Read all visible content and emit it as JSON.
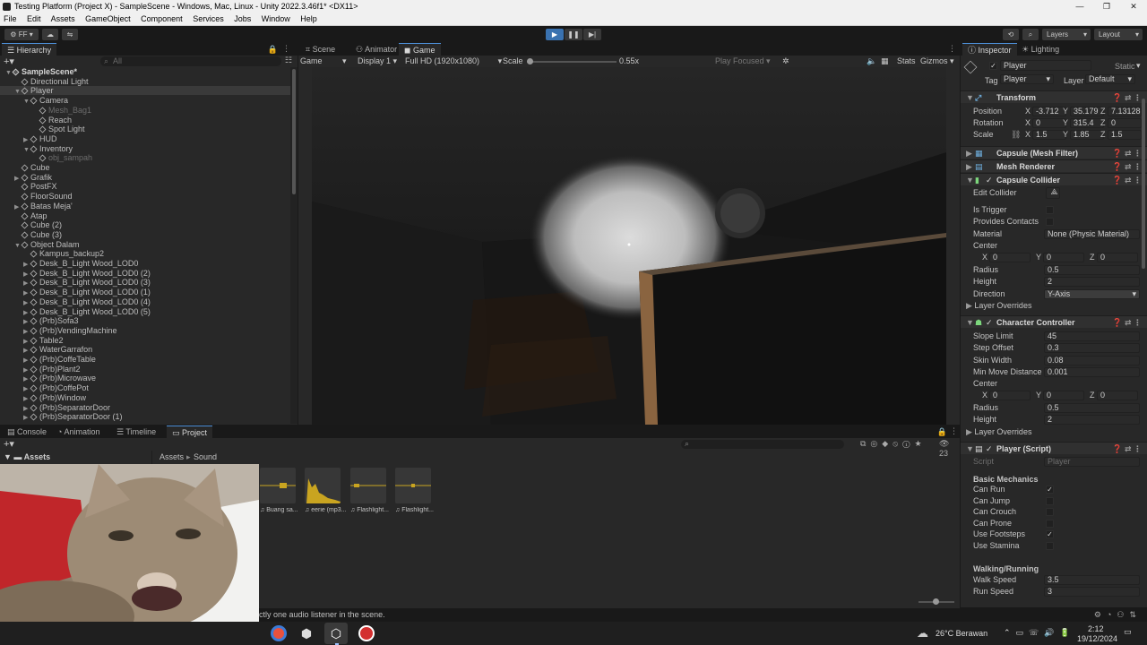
{
  "window": {
    "title": "Testing Platform (Project X) - SampleScene - Windows, Mac, Linux - Unity 2022.3.46f1* <DX11>"
  },
  "menu": [
    "File",
    "Edit",
    "Assets",
    "GameObject",
    "Component",
    "Services",
    "Jobs",
    "Window",
    "Help"
  ],
  "toolbar": {
    "account": "FF",
    "layers": "Layers",
    "layout": "Layout"
  },
  "hierarchy": {
    "tab": "Hierarchy",
    "search_placeholder": "All",
    "items": [
      {
        "label": "SampleScene*",
        "depth": 0,
        "arrow": "▼",
        "dim": false,
        "icon": "unity"
      },
      {
        "label": "Directional Light",
        "depth": 1,
        "arrow": "",
        "dim": false
      },
      {
        "label": "Player",
        "depth": 1,
        "arrow": "▼",
        "dim": false
      },
      {
        "label": "Camera",
        "depth": 2,
        "arrow": "▼",
        "dim": false
      },
      {
        "label": "Mesh_Bag1",
        "depth": 3,
        "arrow": "",
        "dim": true
      },
      {
        "label": "Reach",
        "depth": 3,
        "arrow": "",
        "dim": false
      },
      {
        "label": "Spot Light",
        "depth": 3,
        "arrow": "",
        "dim": false
      },
      {
        "label": "HUD",
        "depth": 2,
        "arrow": "▶",
        "dim": false
      },
      {
        "label": "Inventory",
        "depth": 2,
        "arrow": "▼",
        "dim": false
      },
      {
        "label": "obj_sampah",
        "depth": 3,
        "arrow": "",
        "dim": true
      },
      {
        "label": "Cube",
        "depth": 1,
        "arrow": "",
        "dim": false
      },
      {
        "label": "Grafik",
        "depth": 1,
        "arrow": "▶",
        "dim": false
      },
      {
        "label": "PostFX",
        "depth": 1,
        "arrow": "",
        "dim": false
      },
      {
        "label": "FloorSound",
        "depth": 1,
        "arrow": "",
        "dim": false
      },
      {
        "label": "Batas Meja'",
        "depth": 1,
        "arrow": "▶",
        "dim": false
      },
      {
        "label": "Atap",
        "depth": 1,
        "arrow": "",
        "dim": false
      },
      {
        "label": "Cube (2)",
        "depth": 1,
        "arrow": "",
        "dim": false
      },
      {
        "label": "Cube (3)",
        "depth": 1,
        "arrow": "",
        "dim": false
      },
      {
        "label": "Object Dalam",
        "depth": 1,
        "arrow": "▼",
        "dim": false
      },
      {
        "label": "Kampus_backup2",
        "depth": 2,
        "arrow": "",
        "dim": false
      },
      {
        "label": "Desk_B_Light Wood_LOD0",
        "depth": 2,
        "arrow": "▶",
        "dim": false
      },
      {
        "label": "Desk_B_Light Wood_LOD0 (2)",
        "depth": 2,
        "arrow": "▶",
        "dim": false
      },
      {
        "label": "Desk_B_Light Wood_LOD0 (3)",
        "depth": 2,
        "arrow": "▶",
        "dim": false
      },
      {
        "label": "Desk_B_Light Wood_LOD0 (1)",
        "depth": 2,
        "arrow": "▶",
        "dim": false
      },
      {
        "label": "Desk_B_Light Wood_LOD0 (4)",
        "depth": 2,
        "arrow": "▶",
        "dim": false
      },
      {
        "label": "Desk_B_Light Wood_LOD0 (5)",
        "depth": 2,
        "arrow": "▶",
        "dim": false
      },
      {
        "label": "(Prb)Sofa3",
        "depth": 2,
        "arrow": "▶",
        "dim": false
      },
      {
        "label": "(Prb)VendingMachine",
        "depth": 2,
        "arrow": "▶",
        "dim": false
      },
      {
        "label": "Table2",
        "depth": 2,
        "arrow": "▶",
        "dim": false
      },
      {
        "label": "WaterGarrafon",
        "depth": 2,
        "arrow": "▶",
        "dim": false
      },
      {
        "label": "(Prb)CoffeTable",
        "depth": 2,
        "arrow": "▶",
        "dim": false
      },
      {
        "label": "(Prb)Plant2",
        "depth": 2,
        "arrow": "▶",
        "dim": false
      },
      {
        "label": "(Prb)Microwave",
        "depth": 2,
        "arrow": "▶",
        "dim": false
      },
      {
        "label": "(Prb)CoffePot",
        "depth": 2,
        "arrow": "▶",
        "dim": false
      },
      {
        "label": "(Prb)Window",
        "depth": 2,
        "arrow": "▶",
        "dim": false
      },
      {
        "label": "(Prb)SeparatorDoor",
        "depth": 2,
        "arrow": "▶",
        "dim": false
      },
      {
        "label": "(Prb)SeparatorDoor (1)",
        "depth": 2,
        "arrow": "▶",
        "dim": false
      }
    ]
  },
  "game_view": {
    "tabs": [
      "Scene",
      "Animator",
      "Game"
    ],
    "display_mode": "Game",
    "display": "Display 1",
    "resolution": "Full HD (1920x1080)",
    "scale_label": "Scale",
    "scale_value": "0.55x",
    "play_focused": "Play Focused",
    "stats": "Stats",
    "gizmos": "Gizmos",
    "scale_fraction": 0.0
  },
  "inspector": {
    "tabs": [
      "Inspector",
      "Lighting"
    ],
    "object_name": "Player",
    "static_label": "Static",
    "tag_label": "Tag",
    "tag_value": "Player",
    "layer_label": "Layer",
    "layer_value": "Default",
    "transform": {
      "title": "Transform",
      "position_label": "Position",
      "position": {
        "x": "-3.712",
        "y": "35.179",
        "z": "7.13128"
      },
      "rotation_label": "Rotation",
      "rotation": {
        "x": "0",
        "y": "315.4",
        "z": "0"
      },
      "scale_label": "Scale",
      "scale": {
        "x": "1.5",
        "y": "1.85",
        "z": "1.5"
      }
    },
    "mesh_filter": "Capsule (Mesh Filter)",
    "mesh_renderer": "Mesh Renderer",
    "capsule_collider": {
      "title": "Capsule Collider",
      "edit_collider": "Edit Collider",
      "is_trigger": "Is Trigger",
      "provides_contacts": "Provides Contacts",
      "material_label": "Material",
      "material_value": "None (Physic Material)",
      "center_label": "Center",
      "center": {
        "x": "0",
        "y": "0",
        "z": "0"
      },
      "radius_label": "Radius",
      "radius": "0.5",
      "height_label": "Height",
      "height": "2",
      "direction_label": "Direction",
      "direction": "Y-Axis",
      "layer_overrides": "Layer Overrides"
    },
    "character_controller": {
      "title": "Character Controller",
      "slope_limit_label": "Slope Limit",
      "slope_limit": "45",
      "step_offset_label": "Step Offset",
      "step_offset": "0.3",
      "skin_width_label": "Skin Width",
      "skin_width": "0.08",
      "min_move_label": "Min Move Distance",
      "min_move": "0.001",
      "center_label": "Center",
      "center": {
        "x": "0",
        "y": "0",
        "z": "0"
      },
      "radius_label": "Radius",
      "radius": "0.5",
      "height_label": "Height",
      "height": "2",
      "layer_overrides": "Layer Overrides"
    },
    "player_script": {
      "title": "Player (Script)",
      "script_label": "Script",
      "script_value": "Player",
      "basic_header": "Basic Mechanics",
      "can_run": "Can Run",
      "can_jump": "Can Jump",
      "can_crouch": "Can Crouch",
      "can_prone": "Can Prone",
      "use_footsteps": "Use Footsteps",
      "use_stamina": "Use Stamina",
      "walking_header": "Walking/Running",
      "walk_speed_label": "Walk Speed",
      "walk_speed": "3.5",
      "run_speed_label": "Run Speed",
      "run_speed": "3"
    }
  },
  "bottom": {
    "tabs": [
      "Console",
      "Animation",
      "Timeline",
      "Project"
    ],
    "count": "23",
    "assets_root": "Assets",
    "breadcrumb": [
      "Assets",
      "Sound"
    ],
    "assets": [
      "Buang sa...",
      "eerie (mp3...",
      "Flashlight...",
      "Flashlight..."
    ],
    "status": "ctly one audio listener in the scene."
  },
  "taskbar": {
    "weather": "26°C  Berawan",
    "time": "2:12",
    "date": "19/12/2024"
  },
  "colors": {
    "accent": "#4d90d9",
    "panel": "#282828",
    "header": "#191919",
    "check": "#d8d8d8"
  }
}
